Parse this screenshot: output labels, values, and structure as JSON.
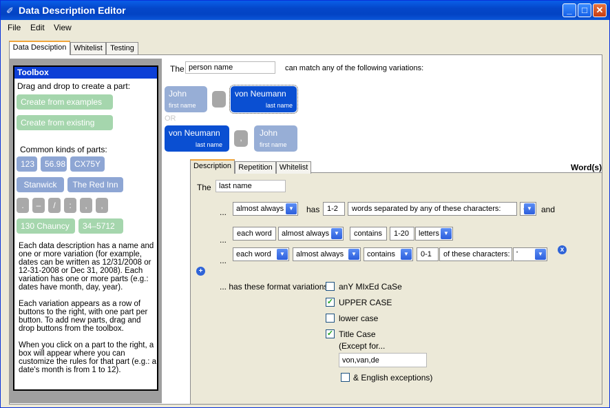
{
  "window": {
    "title": "Data Description Editor"
  },
  "menu": [
    "File",
    "Edit",
    "View"
  ],
  "tabs": [
    "Data Desciption",
    "Whitelist",
    "Testing"
  ],
  "toolbox": {
    "title": "Toolbox",
    "drag_text": "Drag and drop to create a part:",
    "create_examples": "Create from examples",
    "create_existing": "Create from existing",
    "common_label": "Common kinds of parts:",
    "parts_row1": [
      "123",
      "56.98",
      "CX75Y"
    ],
    "parts_row2": [
      "Stanwick",
      "The Red Inn"
    ],
    "parts_row3": [
      ".",
      "–",
      "/",
      ":",
      ",",
      ","
    ],
    "parts_row4": [
      "130 Chauncy",
      "34–5712"
    ],
    "desc_p1": "Each data description has a name and one or more variation (for example, dates can be written as 12/31/2008 or 12-31-2008 or Dec 31, 2008). Each variation has one or more parts (e.g.: dates have month, day, year).",
    "desc_p2": "Each variation appears as a row of buttons to the right, with one part per button. To add new parts, drag and drop buttons from the toolbox.",
    "desc_p3": "When you click on a part to the right, a box will appear where you can customize the rules for that part (e.g.: a date's month is from 1 to 12)."
  },
  "header": {
    "the": "The",
    "name_value": "person name",
    "match_text": "can match any of the following variations:"
  },
  "variation1": {
    "part1_name": "John",
    "part1_sub": "first name",
    "part3_name": "von Neumann",
    "part3_sub": "last name"
  },
  "or_label": "OR",
  "variation2": {
    "part1_name": "von Neumann",
    "part1_sub": "last name",
    "part2": ",",
    "part3_name": "John",
    "part3_sub": "first name"
  },
  "inner_tabs": [
    "Description",
    "Repetition",
    "Whitelist"
  ],
  "words_label": "Word(s)",
  "desc": {
    "the": "The",
    "part_name": "last name",
    "row1": {
      "dots": "...",
      "freq": "almost always",
      "has": "has",
      "count": "1-2",
      "words_sep": "words separated by any of these characters:",
      "char": "-",
      "and": "and"
    },
    "row2": {
      "dots": "...",
      "scope": "each word",
      "freq": "almost always",
      "contains": "contains",
      "count": "1-20",
      "unit": "letters"
    },
    "row3": {
      "dots": "...",
      "scope": "each word",
      "freq": "almost always",
      "contains": "contains",
      "count": "0-1",
      "unit": "of these characters:",
      "char": "'"
    },
    "add_icon": "+",
    "remove_icon": "x",
    "format_label": "... has these format variations:",
    "formats": [
      {
        "label": "anY MIxEd CaSe",
        "checked": false
      },
      {
        "label": "UPPER CASE",
        "checked": true
      },
      {
        "label": "lower case",
        "checked": false
      },
      {
        "label": "Title Case",
        "checked": true
      }
    ],
    "except_label": "(Except for...",
    "except_value": "von,van,de",
    "english_label": "& English exceptions)",
    "english_checked": false
  }
}
